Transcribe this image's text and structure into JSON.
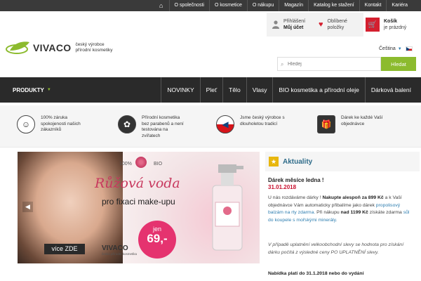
{
  "topnav": {
    "items": [
      "O společnosti",
      "O kosmetice",
      "O nákupu",
      "Magazín",
      "Katalog ke stažení",
      "Kontakt",
      "Kariéra"
    ]
  },
  "header": {
    "brand": "VIVACO",
    "tagline_1": "český výrobce",
    "tagline_2": "přírodní kosmetiky",
    "login_line1": "Přihlášení",
    "login_line2": "Můj účet",
    "fav_line1": "Oblíbené",
    "fav_line2": "položky",
    "cart_line1": "Košík",
    "cart_line2": "je prázdný",
    "language": "Čeština",
    "search_placeholder": "Hledej",
    "search_button": "Hledat"
  },
  "nav": {
    "products": "PRODUKTY",
    "items": [
      "NOVINKY",
      "Pleť",
      "Tělo",
      "Vlasy",
      "BIO kosmetika a přírodní oleje",
      "Dárková balení"
    ]
  },
  "features": [
    {
      "l1": "100% záruka",
      "l2": "spokojenosti našich",
      "l3": "zákazníků",
      "l4": "",
      "icon": "smiley-icon"
    },
    {
      "l1": "Přírodní kosmetika",
      "l2": "bez parabenů a není",
      "l3": "testována na",
      "l4": "zvířatech",
      "icon": "vegan-icon"
    },
    {
      "l1": "Jsme český výrobce s",
      "l2": "dlouholetou tradicí",
      "l3": "",
      "l4": "",
      "icon": "czech-flag-icon"
    },
    {
      "l1": "Dárek ke každé Vaší",
      "l2": "objednávce",
      "l3": "",
      "l4": "",
      "icon": "gift-icon"
    }
  ],
  "banner": {
    "percent": "100%",
    "bio": "BIO",
    "title": "Růžová voda",
    "subtitle": "pro fixaci make-upu",
    "badge_small": "jen",
    "badge_price": "69,-",
    "more": "více ZDE",
    "logo": "VIVACO",
    "logo_sub": "česká přírodní kosmetika"
  },
  "news": {
    "title": "Aktuality",
    "item_title": "Dárek měsíce ledna !",
    "item_date": "31.01.2018",
    "p1": "U nás rozdáváme dárky !",
    "p1b": "Nakupte alespoň za 899 Kč",
    "p1c": "a k Vaší objednávce Vám automaticky přibalíme jako dárek",
    "p1link": "propolisový balzám na rty zdarma.",
    "p1d": "Při nákupu",
    "p1e": "nad 1199 Kč",
    "p1f": "získáte zdarma",
    "p1link2": "sůl do koupele s mořskými minerály.",
    "p2": "V případě uplatnění velkoobchodní slevy se hodnota pro získání dárku počítá z výsledné ceny PO UPLATNĚNÍ slevy.",
    "p3": "Nabídka platí do 31.1.2018 nebo do vydání"
  }
}
